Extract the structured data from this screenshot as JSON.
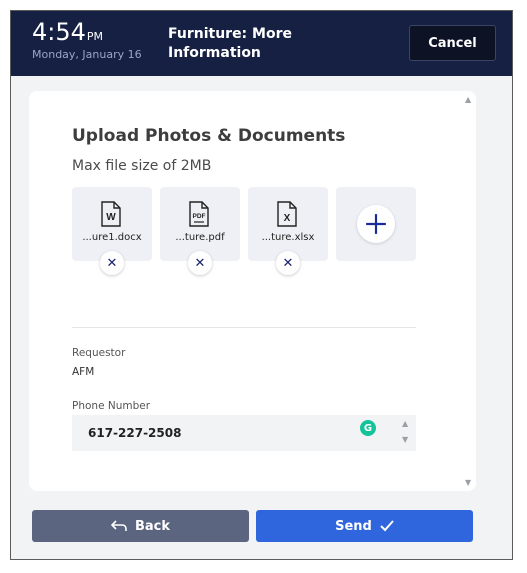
{
  "header": {
    "time": "4:54",
    "ampm": "PM",
    "date": "Monday, January 16",
    "title": "Furniture: More Information",
    "cancel_label": "Cancel"
  },
  "upload": {
    "title": "Upload Photos & Documents",
    "max_size": "Max file size of 2MB",
    "files": [
      {
        "name": "...ure1.docx",
        "type": "W"
      },
      {
        "name": "...ture.pdf",
        "type": "PDF"
      },
      {
        "name": "...ture.xlsx",
        "type": "X"
      }
    ]
  },
  "requestor": {
    "label": "Requestor",
    "value": "AFM"
  },
  "phone": {
    "label": "Phone Number",
    "value": "617-227-2508"
  },
  "footer": {
    "back_label": "Back",
    "send_label": "Send"
  },
  "colors": {
    "header_bg": "#152043",
    "accent": "#2f66dd",
    "back_bg": "#5c6580",
    "grammarly": "#15c39a"
  }
}
